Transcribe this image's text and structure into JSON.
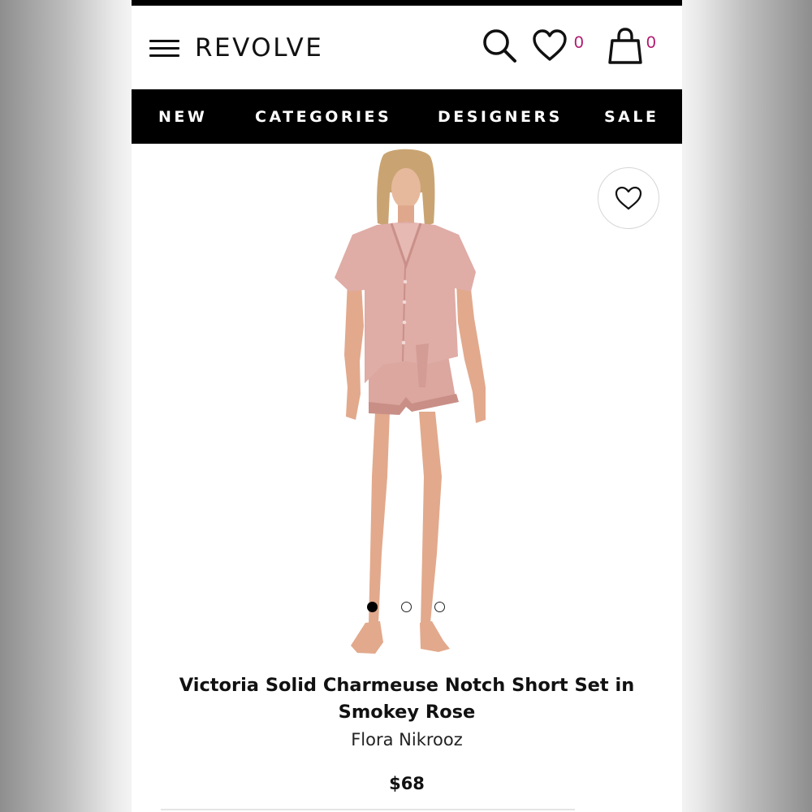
{
  "header": {
    "logo": "REVOLVE",
    "wishlist_count": "0",
    "bag_count": "0"
  },
  "nav": {
    "items": [
      "NEW",
      "CATEGORIES",
      "DESIGNERS",
      "SALE"
    ]
  },
  "product": {
    "title_line1": "Victoria Solid Charmeuse Notch Short Set in",
    "title_line2": "Smokey Rose",
    "brand": "Flora Nikrooz",
    "price": "$68",
    "image_count": 3,
    "active_image": 1
  },
  "icons": {
    "menu": "hamburger-menu-icon",
    "search": "search-icon",
    "wishlist": "heart-icon",
    "bag": "shopping-bag-icon",
    "favorite": "heart-outline-icon"
  },
  "colors": {
    "nav_bg": "#000000",
    "count_accent": "#b0176e",
    "garment": "#dfaca6"
  }
}
